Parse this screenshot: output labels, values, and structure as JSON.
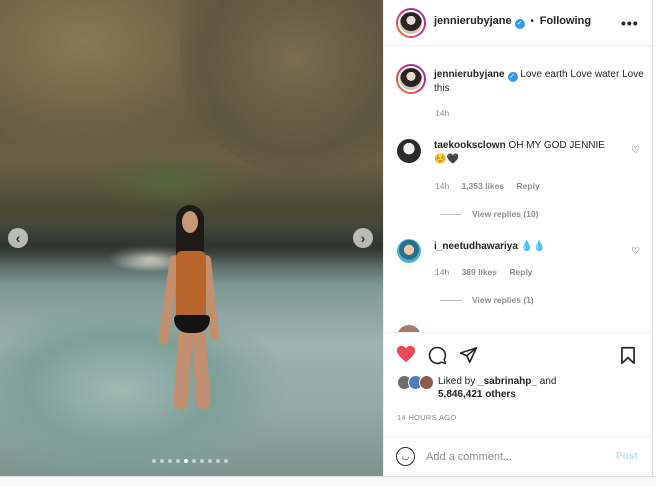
{
  "header": {
    "username": "jennierubyjane",
    "separator": "•",
    "follow_status": "Following",
    "more_glyph": "•••"
  },
  "caption": {
    "username": "jennierubyjane",
    "text": "Love earth Love water Love this",
    "time": "14h"
  },
  "comments": [
    {
      "username": "taekooksclown",
      "text": "OH MY GOD JENNIE",
      "emoji": "☺️🖤",
      "time": "14h",
      "likes": "1,353 likes",
      "reply": "Reply",
      "view_replies": "View replies (10)"
    },
    {
      "username": "i_neetudhawariya",
      "emoji": "💧💧",
      "time": "14h",
      "likes": "389 likes",
      "reply": "Reply",
      "view_replies": "View replies (1)"
    }
  ],
  "actions": {
    "like_icon": "heart-filled-icon",
    "comment_icon": "comment-icon",
    "share_icon": "share-icon",
    "save_icon": "bookmark-icon",
    "liked_by_prefix": "Liked by",
    "liked_by_user": "_sabrinahp_",
    "and": "and",
    "others_count": "5,846,421 others",
    "timestamp": "14 HOURS AGO",
    "like_color": "#ed4956"
  },
  "add_comment": {
    "placeholder": "Add a comment...",
    "post_label": "Post"
  },
  "carousel": {
    "prev_glyph": "‹",
    "next_glyph": "›",
    "dot_count": 10,
    "active_index": 4
  }
}
